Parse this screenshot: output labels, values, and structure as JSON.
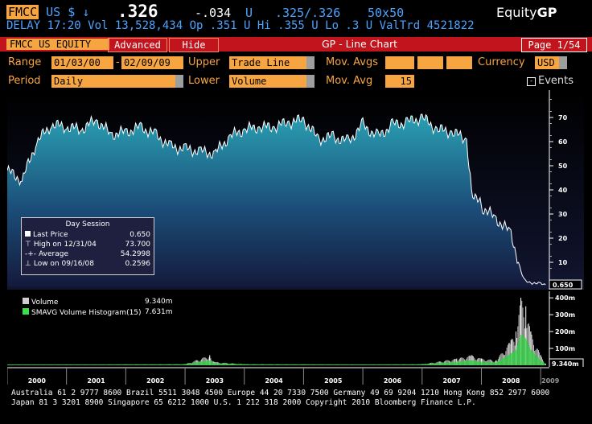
{
  "header": {
    "ticker": "FMCC",
    "market": "US",
    "currency_symbol": "$",
    "arrow": "↓",
    "last": ".326",
    "change": "-.034",
    "flag": "U",
    "bid_ask": ".325/.326",
    "size": "50x50",
    "product_prefix": "Equity",
    "product_code": "GP"
  },
  "subheader": {
    "text": "DELAY 17:20 Vol 13,528,434 Op .351 U Hi .355 U Lo .3 U ValTrd  4521822"
  },
  "toolbar": {
    "security": "FMCC US EQUITY",
    "advanced": "Advanced",
    "hide": "Hide",
    "title": "GP - Line Chart",
    "page": "Page 1/54"
  },
  "form": {
    "range_label": "Range",
    "start_date": "01/03/00",
    "dash": "-",
    "end_date": "02/09/09",
    "upper_label": "Upper",
    "upper_value": "Trade Line",
    "mov_avgs_label": "Mov. Avgs",
    "currency_label": "Currency",
    "currency_value": "USD",
    "period_label": "Period",
    "period_value": "Daily",
    "lower_label": "Lower",
    "lower_value": "Volume",
    "mov_avg_label": "Mov. Avg",
    "mov_avg_value": "15",
    "events_label": "Events"
  },
  "legend": {
    "title": "Day Session",
    "last_label": "Last Price",
    "last_value": "0.650",
    "high_label": "High on 12/31/04",
    "high_value": "73.700",
    "avg_label": "Average",
    "avg_value": "54.2998",
    "low_label": "Low on 09/16/08",
    "low_value": "0.2596"
  },
  "vol_legend": {
    "volume_label": "Volume",
    "volume_value": "9.340m",
    "smavg_label": "SMAVG Volume Histogram(15)",
    "smavg_value": "7.631m"
  },
  "price_tag": "0.650",
  "vol_tag": "9.340m",
  "footer": {
    "line1": "Australia 61 2 9777 8600 Brazil 5511 3048 4500 Europe 44 20 7330 7500 Germany 49 69 9204 1210 Hong Kong 852 2977 6000",
    "line2": "Japan 81 3 3201 8900        Singapore 65 6212 1000       U.S. 1 212 318 2000        Copyright 2010 Bloomberg Finance L.P."
  },
  "chart_data": [
    {
      "type": "area",
      "series_name": "Last Price",
      "x": [
        "2000-01",
        "2000-04",
        "2000-07",
        "2000-10",
        "2001-01",
        "2001-04",
        "2001-07",
        "2001-10",
        "2002-01",
        "2002-04",
        "2002-07",
        "2002-10",
        "2003-01",
        "2003-04",
        "2003-07",
        "2003-10",
        "2004-01",
        "2004-04",
        "2004-07",
        "2004-10",
        "2005-01",
        "2005-04",
        "2005-07",
        "2005-10",
        "2006-01",
        "2006-04",
        "2006-07",
        "2006-10",
        "2007-01",
        "2007-04",
        "2007-07",
        "2007-10",
        "2007-11",
        "2008-01",
        "2008-04",
        "2008-07",
        "2008-09",
        "2008-10",
        "2009-01",
        "2009-02"
      ],
      "values": [
        48,
        44,
        60,
        67,
        66,
        65,
        69,
        63,
        64,
        66,
        63,
        58,
        57,
        56,
        55,
        62,
        65,
        66,
        66,
        68,
        69,
        61,
        62,
        60,
        67,
        62,
        67,
        68,
        70,
        65,
        64,
        61,
        40,
        33,
        28,
        22,
        6,
        2,
        1,
        0.65
      ],
      "ylim": [
        0,
        80
      ],
      "yticks": [
        10,
        20,
        30,
        40,
        50,
        60,
        70
      ],
      "xticks": [
        "2000",
        "2001",
        "2002",
        "2003",
        "2004",
        "2005",
        "2006",
        "2007",
        "2008",
        "2009"
      ],
      "grid": false
    },
    {
      "type": "bar",
      "series": [
        {
          "name": "Volume",
          "unit": "m"
        },
        {
          "name": "SMAVG Volume Histogram(15)",
          "unit": "m"
        }
      ],
      "x": [
        "2000-01",
        "2001-01",
        "2002-01",
        "2003-01",
        "2003-06",
        "2003-07",
        "2004-01",
        "2005-01",
        "2006-01",
        "2007-01",
        "2007-08",
        "2007-11",
        "2008-01",
        "2008-04",
        "2008-07",
        "2008-08",
        "2008-09",
        "2008-10",
        "2008-11",
        "2009-01",
        "2009-02"
      ],
      "values": [
        4,
        4,
        5,
        6,
        60,
        20,
        6,
        5,
        4,
        6,
        40,
        60,
        40,
        30,
        150,
        200,
        400,
        350,
        200,
        60,
        9.34
      ],
      "ylim": [
        0,
        420
      ],
      "yticks": [
        100,
        200,
        300,
        400
      ],
      "ytick_labels": [
        "100m",
        "200m",
        "300m",
        "400m"
      ]
    }
  ]
}
